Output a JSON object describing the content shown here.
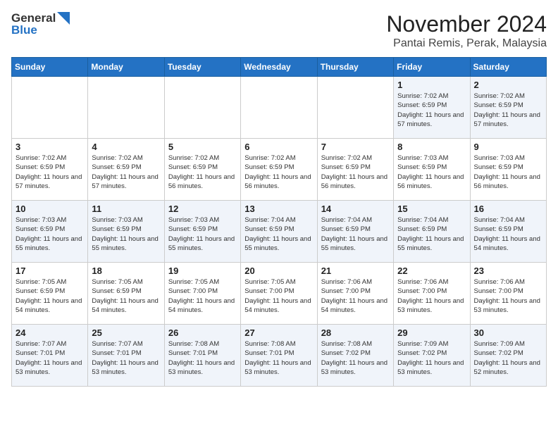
{
  "header": {
    "logo_general": "General",
    "logo_blue": "Blue",
    "month_title": "November 2024",
    "location": "Pantai Remis, Perak, Malaysia"
  },
  "weekdays": [
    "Sunday",
    "Monday",
    "Tuesday",
    "Wednesday",
    "Thursday",
    "Friday",
    "Saturday"
  ],
  "weeks": [
    [
      {
        "day": "",
        "sunrise": "",
        "sunset": "",
        "daylight": ""
      },
      {
        "day": "",
        "sunrise": "",
        "sunset": "",
        "daylight": ""
      },
      {
        "day": "",
        "sunrise": "",
        "sunset": "",
        "daylight": ""
      },
      {
        "day": "",
        "sunrise": "",
        "sunset": "",
        "daylight": ""
      },
      {
        "day": "",
        "sunrise": "",
        "sunset": "",
        "daylight": ""
      },
      {
        "day": "1",
        "sunrise": "7:02 AM",
        "sunset": "6:59 PM",
        "daylight": "11 hours and 57 minutes."
      },
      {
        "day": "2",
        "sunrise": "7:02 AM",
        "sunset": "6:59 PM",
        "daylight": "11 hours and 57 minutes."
      }
    ],
    [
      {
        "day": "3",
        "sunrise": "7:02 AM",
        "sunset": "6:59 PM",
        "daylight": "11 hours and 57 minutes."
      },
      {
        "day": "4",
        "sunrise": "7:02 AM",
        "sunset": "6:59 PM",
        "daylight": "11 hours and 57 minutes."
      },
      {
        "day": "5",
        "sunrise": "7:02 AM",
        "sunset": "6:59 PM",
        "daylight": "11 hours and 56 minutes."
      },
      {
        "day": "6",
        "sunrise": "7:02 AM",
        "sunset": "6:59 PM",
        "daylight": "11 hours and 56 minutes."
      },
      {
        "day": "7",
        "sunrise": "7:02 AM",
        "sunset": "6:59 PM",
        "daylight": "11 hours and 56 minutes."
      },
      {
        "day": "8",
        "sunrise": "7:03 AM",
        "sunset": "6:59 PM",
        "daylight": "11 hours and 56 minutes."
      },
      {
        "day": "9",
        "sunrise": "7:03 AM",
        "sunset": "6:59 PM",
        "daylight": "11 hours and 56 minutes."
      }
    ],
    [
      {
        "day": "10",
        "sunrise": "7:03 AM",
        "sunset": "6:59 PM",
        "daylight": "11 hours and 55 minutes."
      },
      {
        "day": "11",
        "sunrise": "7:03 AM",
        "sunset": "6:59 PM",
        "daylight": "11 hours and 55 minutes."
      },
      {
        "day": "12",
        "sunrise": "7:03 AM",
        "sunset": "6:59 PM",
        "daylight": "11 hours and 55 minutes."
      },
      {
        "day": "13",
        "sunrise": "7:04 AM",
        "sunset": "6:59 PM",
        "daylight": "11 hours and 55 minutes."
      },
      {
        "day": "14",
        "sunrise": "7:04 AM",
        "sunset": "6:59 PM",
        "daylight": "11 hours and 55 minutes."
      },
      {
        "day": "15",
        "sunrise": "7:04 AM",
        "sunset": "6:59 PM",
        "daylight": "11 hours and 55 minutes."
      },
      {
        "day": "16",
        "sunrise": "7:04 AM",
        "sunset": "6:59 PM",
        "daylight": "11 hours and 54 minutes."
      }
    ],
    [
      {
        "day": "17",
        "sunrise": "7:05 AM",
        "sunset": "6:59 PM",
        "daylight": "11 hours and 54 minutes."
      },
      {
        "day": "18",
        "sunrise": "7:05 AM",
        "sunset": "6:59 PM",
        "daylight": "11 hours and 54 minutes."
      },
      {
        "day": "19",
        "sunrise": "7:05 AM",
        "sunset": "7:00 PM",
        "daylight": "11 hours and 54 minutes."
      },
      {
        "day": "20",
        "sunrise": "7:05 AM",
        "sunset": "7:00 PM",
        "daylight": "11 hours and 54 minutes."
      },
      {
        "day": "21",
        "sunrise": "7:06 AM",
        "sunset": "7:00 PM",
        "daylight": "11 hours and 54 minutes."
      },
      {
        "day": "22",
        "sunrise": "7:06 AM",
        "sunset": "7:00 PM",
        "daylight": "11 hours and 53 minutes."
      },
      {
        "day": "23",
        "sunrise": "7:06 AM",
        "sunset": "7:00 PM",
        "daylight": "11 hours and 53 minutes."
      }
    ],
    [
      {
        "day": "24",
        "sunrise": "7:07 AM",
        "sunset": "7:01 PM",
        "daylight": "11 hours and 53 minutes."
      },
      {
        "day": "25",
        "sunrise": "7:07 AM",
        "sunset": "7:01 PM",
        "daylight": "11 hours and 53 minutes."
      },
      {
        "day": "26",
        "sunrise": "7:08 AM",
        "sunset": "7:01 PM",
        "daylight": "11 hours and 53 minutes."
      },
      {
        "day": "27",
        "sunrise": "7:08 AM",
        "sunset": "7:01 PM",
        "daylight": "11 hours and 53 minutes."
      },
      {
        "day": "28",
        "sunrise": "7:08 AM",
        "sunset": "7:02 PM",
        "daylight": "11 hours and 53 minutes."
      },
      {
        "day": "29",
        "sunrise": "7:09 AM",
        "sunset": "7:02 PM",
        "daylight": "11 hours and 53 minutes."
      },
      {
        "day": "30",
        "sunrise": "7:09 AM",
        "sunset": "7:02 PM",
        "daylight": "11 hours and 52 minutes."
      }
    ]
  ]
}
